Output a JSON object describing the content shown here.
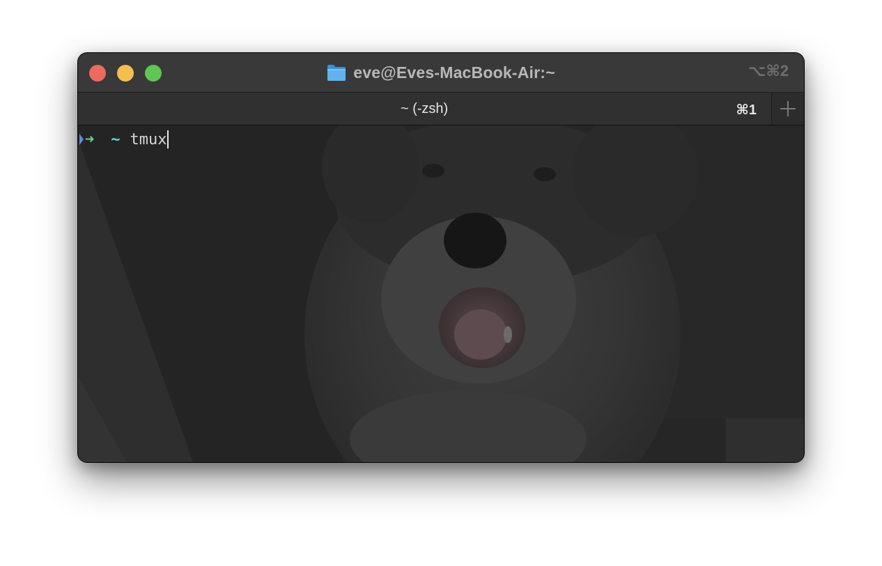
{
  "window": {
    "title": "eve@Eves-MacBook-Air:~",
    "shortcut": "⌥⌘2",
    "title_icon": "folder-icon",
    "traffic_lights": {
      "close": "#ed6a5e",
      "minimize": "#f5bf4f",
      "zoom": "#61c554"
    }
  },
  "tabs": [
    {
      "label": "~ (-zsh)",
      "shortcut": "⌘1",
      "active": true
    }
  ],
  "new_tab": {
    "icon": "plus-icon"
  },
  "terminal": {
    "prompt_arrow": "➜",
    "prompt_dir": "~",
    "command": "tmux",
    "background_image": "dog-photo"
  },
  "colors": {
    "titlebar": "#393939",
    "tabbar": "#303030",
    "terminal_bg": "#262626",
    "prompt_arrow": "#6fd38a",
    "prompt_dir": "#64d6e6",
    "text": "#d6d6d6"
  }
}
